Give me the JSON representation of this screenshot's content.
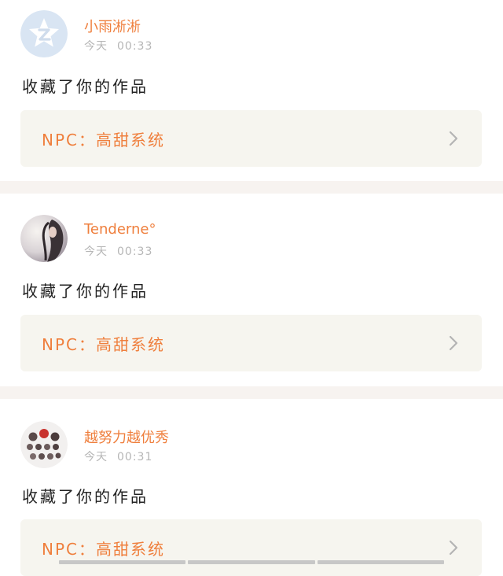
{
  "feed": {
    "items": [
      {
        "username": "小雨淅淅",
        "day": "今天",
        "time": "00:33",
        "action": "收藏了你的作品",
        "work_prefix": "NPC：",
        "work_title": "高甜系统"
      },
      {
        "username": "Tenderne°",
        "day": "今天",
        "time": "00:33",
        "action": "收藏了你的作品",
        "work_prefix": "NPC：",
        "work_title": "高甜系统"
      },
      {
        "username": "越努力越优秀",
        "day": "今天",
        "time": "00:31",
        "action": "收藏了你的作品",
        "work_prefix": "NPC：",
        "work_title": "高甜系统"
      }
    ]
  },
  "colors": {
    "accent": "#ef7f3d",
    "timestamp": "#b6b6b6",
    "card_bg": "#f6f5ef",
    "separator": "#f7f3f0"
  },
  "icons": {
    "avatar_1": "qq-star-avatar",
    "avatar_2": "profile-photo-avatar",
    "avatar_3": "group-collage-avatar",
    "link_arrow": "chevron-right-icon"
  }
}
